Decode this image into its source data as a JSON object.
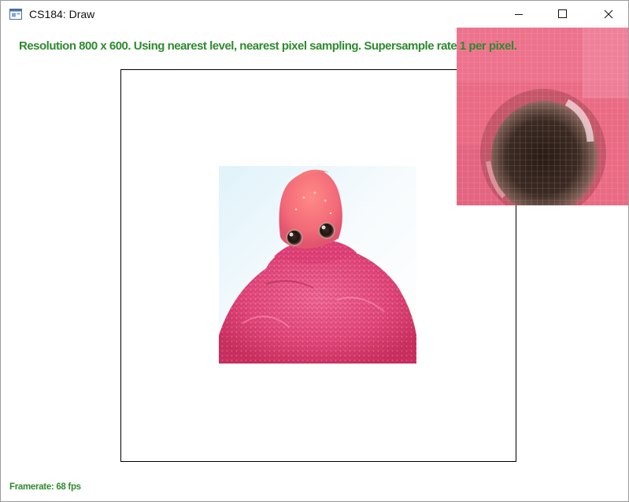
{
  "window": {
    "title": "CS184: Draw",
    "icon": "app-window-icon",
    "buttons": {
      "minimize": "minimize-icon",
      "maximize": "maximize-icon",
      "close": "close-icon"
    }
  },
  "status": {
    "text": "Resolution 800 x 600. Using nearest level, nearest pixel sampling. Supersample rate 1 per pixel."
  },
  "footer": {
    "framerate": "Framerate: 68 fps"
  },
  "colors": {
    "status_text": "#2e8b2e",
    "frame_border": "#000000",
    "background": "#ffffff",
    "texture_pink": "#e8607e"
  },
  "canvas": {
    "texture_subject": "pink fuzzy creature with large eyes",
    "zoom_panel": "pixel-grid magnified view of the creature's eye"
  }
}
